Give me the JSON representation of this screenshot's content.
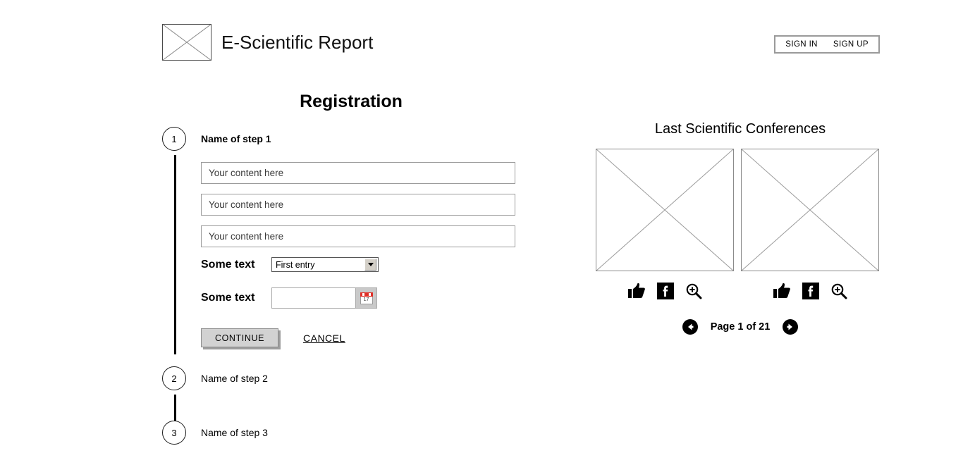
{
  "header": {
    "logo_alt": "image-placeholder",
    "brand_title": "E-Scientific Report",
    "sign_in": "SIGN IN",
    "sign_up": "SIGN UP"
  },
  "page": {
    "title": "Registration"
  },
  "stepper": {
    "steps": [
      {
        "number": "1",
        "label": "Name of step 1"
      },
      {
        "number": "2",
        "label": "Name of step 2"
      },
      {
        "number": "3",
        "label": "Name of step 3"
      }
    ]
  },
  "form": {
    "inputs": [
      {
        "value": "",
        "placeholder": "Your content here"
      },
      {
        "value": "",
        "placeholder": "Your content here"
      },
      {
        "value": "",
        "placeholder": "Your content here"
      }
    ],
    "select_row": {
      "label": "Some text",
      "selected": "First entry",
      "options": [
        "First entry"
      ]
    },
    "date_row": {
      "label": "Some text",
      "value": "",
      "placeholder": "",
      "calendar_day": "17"
    },
    "continue_label": "CONTINUE",
    "cancel_label": "CANCEL"
  },
  "right_panel": {
    "title": "Last Scientific Conferences",
    "cards": [
      {
        "image_alt": "image-placeholder",
        "actions": [
          "thumbs-up-icon",
          "facebook-icon",
          "zoom-in-icon"
        ]
      },
      {
        "image_alt": "image-placeholder",
        "actions": [
          "thumbs-up-icon",
          "facebook-icon",
          "zoom-in-icon"
        ]
      }
    ],
    "pagination": {
      "prev_icon": "arrow-left-circle-icon",
      "text": "Page 1 of 21",
      "next_icon": "arrow-right-circle-icon",
      "current_page": 1,
      "total_pages": 21
    }
  },
  "colors": {
    "accent_red": "#e03028",
    "button_gray": "#d2d2d2",
    "border_gray": "#9b9b9b"
  }
}
